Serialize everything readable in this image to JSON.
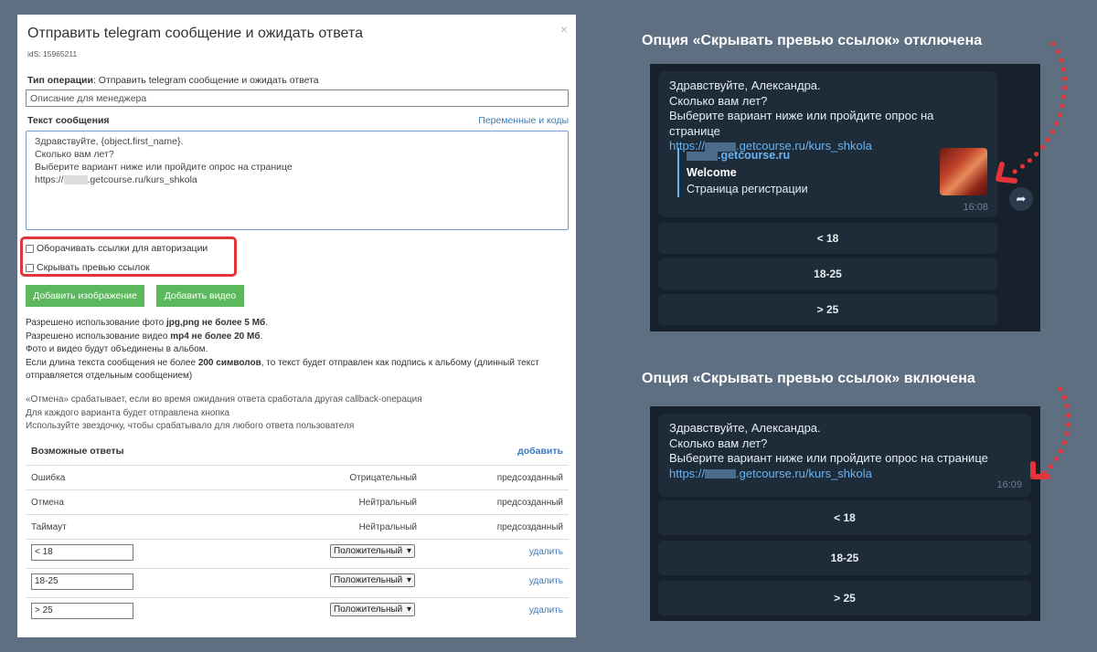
{
  "dialog": {
    "title": "Отправить telegram сообщение и ожидать ответа",
    "close_icon": "×",
    "ids": "idS: 15965211",
    "op_type_label": "Тип операции",
    "op_type_value": ": Отправить telegram сообщение и ожидать ответа",
    "description_placeholder": "Описание для менеджера",
    "message_label": "Текст сообщения",
    "variables_link": "Переменные и коды",
    "message_lines": [
      "Здравствуйте, {object.first_name}.",
      "Сколько вам лет?",
      "Выберите вариант ниже или пройдите опрос на странице",
      "https://",
      ".getcourse.ru/kurs_shkola"
    ],
    "checkbox_wrap": "Оборачивать ссылки для авторизации",
    "checkbox_hide": "Скрывать превью ссылок",
    "btn_add_image": "Добавить изображение",
    "btn_add_video": "Добавить видео",
    "info": {
      "l1a": "Разрешено использование фото ",
      "l1b": "jpg,png не более 5 Мб",
      "l1c": ".",
      "l2a": "Разрешено использование видео ",
      "l2b": "mp4 не более 20 Мб",
      "l2c": ".",
      "l3": "Фото и видео будут объединены в альбом.",
      "l4a": "Если длина текста сообщения не более ",
      "l4b": "200 символов",
      "l4c": ", то текст будет отправлен как подпись к альбому (длинный текст отправляется отдельным сообщением)"
    },
    "info2": [
      "«Отмена» срабатывает, если во время ожидания ответа сработала другая callback-операция",
      "Для каждого варианта будет отправлена кнопка",
      "Используйте звездочку, чтобы срабатывало для любого ответа пользователя"
    ],
    "answers_title": "Возможные ответы",
    "answers_add": "добавить",
    "predefined": [
      {
        "name": "Ошибка",
        "type": "Отрицательный",
        "status": "предсозданный"
      },
      {
        "name": "Отмена",
        "type": "Нейтральный",
        "status": "предсозданный"
      },
      {
        "name": "Таймаут",
        "type": "Нейтральный",
        "status": "предсозданный"
      }
    ],
    "custom": [
      {
        "value": "< 18",
        "type": "Положительный",
        "delete": "удалить"
      },
      {
        "value": "18-25",
        "type": "Положительный",
        "delete": "удалить"
      },
      {
        "value": "> 25",
        "type": "Положительный",
        "delete": "удалить"
      }
    ]
  },
  "top": {
    "heading": "Опция «Скрывать превью ссылок» отключена",
    "msg": [
      "Здравствуйте, Александра.",
      "Сколько вам лет?",
      "Выберите вариант ниже или пройдите опрос на странице"
    ],
    "url_a": "https://",
    "url_b": ".getcourse.ru/kurs_shkola",
    "preview_site": ".getcourse.ru",
    "preview_title": "Welcome",
    "preview_desc": "Страница регистрации",
    "time": "16:08",
    "buttons": [
      "< 18",
      "18-25",
      "> 25"
    ]
  },
  "bottom": {
    "heading": "Опция «Скрывать превью ссылок» включена",
    "msg": [
      "Здравствуйте, Александра.",
      "Сколько вам лет?",
      "Выберите вариант ниже или пройдите опрос на странице"
    ],
    "url_a": "https://",
    "url_b": ".getcourse.ru/kurs_shkola",
    "time": "16:09",
    "buttons": [
      "< 18",
      "18-25",
      "> 25"
    ]
  },
  "colors": {
    "background": "#5e6f82",
    "accent_link": "#3a7bbf",
    "green": "#5cb85c",
    "highlight_red": "#e3343a",
    "tg_bg": "#17212b",
    "tg_link": "#6ab3f3"
  },
  "icons": {
    "close": "close-icon",
    "share": "share-icon",
    "checkbox": "checkbox-icon",
    "chevron": "chevron-down-icon"
  }
}
